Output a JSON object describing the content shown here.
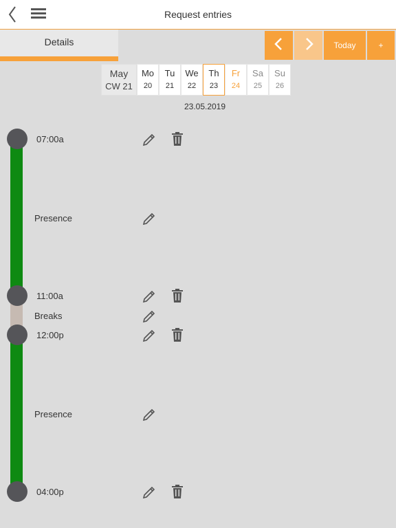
{
  "header": {
    "title": "Request entries",
    "back_icon": "chevron-left-icon",
    "menu_icon": "hamburger-menu-icon"
  },
  "tabs": {
    "details_label": "Details"
  },
  "controls": {
    "today_label": "Today",
    "add_label": "+",
    "accent_color": "#f7a13a"
  },
  "calendar": {
    "month": "May",
    "week": "CW 21",
    "days": [
      {
        "name": "Mo",
        "date": "20"
      },
      {
        "name": "Tu",
        "date": "21"
      },
      {
        "name": "We",
        "date": "22"
      },
      {
        "name": "Th",
        "date": "23",
        "selected": true
      },
      {
        "name": "Fr",
        "date": "24",
        "today": true
      },
      {
        "name": "Sa",
        "date": "25"
      },
      {
        "name": "Su",
        "date": "26"
      }
    ],
    "selected_date": "23.05.2019"
  },
  "timeline": {
    "entries": [
      {
        "time": "07:00a"
      },
      {
        "segment": "Presence"
      },
      {
        "time": "11:00a"
      },
      {
        "segment": "Breaks"
      },
      {
        "time": "12:00p"
      },
      {
        "segment": "Presence"
      },
      {
        "time": "04:00p"
      }
    ],
    "presence_color": "#0e8a12",
    "break_color": "#c6bab2"
  }
}
